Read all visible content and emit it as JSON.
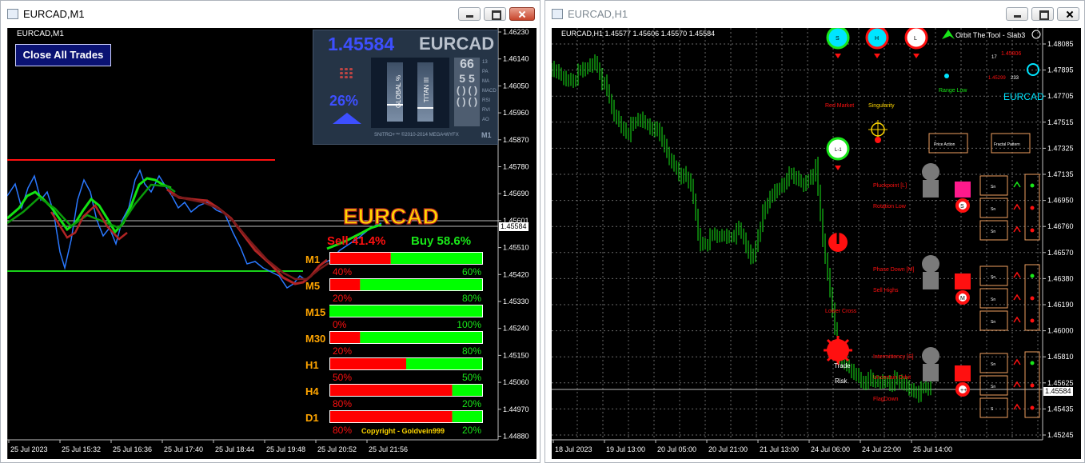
{
  "windows": {
    "m1": {
      "title": "EURCAD,M1",
      "symbol_label": "EURCAD,M1",
      "close_all_label": "Close All Trades",
      "current_price": "1.45584",
      "price_axis": [
        "1.46230",
        "1.46140",
        "1.46050",
        "1.45960",
        "1.45870",
        "1.45780",
        "1.45690",
        "1.45601",
        "1.45510",
        "1.45420",
        "1.45330",
        "1.45240",
        "1.45150",
        "1.45060",
        "1.44970",
        "1.44880"
      ],
      "time_axis": [
        "25 Jul 2023",
        "25 Jul 15:32",
        "25 Jul 16:36",
        "25 Jul 17:40",
        "25 Jul 18:44",
        "25 Jul 19:48",
        "25 Jul 20:52",
        "25 Jul 21:56"
      ],
      "panel": {
        "price": "1.45584",
        "pair": "EURCAD",
        "percent": "26%",
        "col_top": "66",
        "col_values": [
          "5 5",
          "( ) ( )",
          "( ) ( )",
          "( ) ( )"
        ],
        "indicator_labels": [
          "GLOBAL %",
          "TITAN III"
        ],
        "right_labels": [
          "13",
          "PA",
          "MA",
          "MACD",
          "RSI",
          "RVI",
          "AO"
        ],
        "footer": "SNITRO+™ ©2010-2014 MEGA•WYFX",
        "timeframe": "M1"
      },
      "strength": {
        "pair": "EURCAD",
        "sell_label": "Sell 41.4%",
        "buy_label": "Buy 58.6%",
        "copyright": "Copyright - Goldvein999",
        "rows": [
          {
            "tf": "M1",
            "sell": 40,
            "buy": 60,
            "sell_text": "40%",
            "buy_text": "60%"
          },
          {
            "tf": "M5",
            "sell": 20,
            "buy": 80,
            "sell_text": "20%",
            "buy_text": "80%"
          },
          {
            "tf": "M15",
            "sell": 0,
            "buy": 100,
            "sell_text": "0%",
            "buy_text": "100%"
          },
          {
            "tf": "M30",
            "sell": 20,
            "buy": 80,
            "sell_text": "20%",
            "buy_text": "80%"
          },
          {
            "tf": "H1",
            "sell": 50,
            "buy": 50,
            "sell_text": "50%",
            "buy_text": "50%"
          },
          {
            "tf": "H4",
            "sell": 80,
            "buy": 20,
            "sell_text": "80%",
            "buy_text": "20%"
          },
          {
            "tf": "D1",
            "sell": 80,
            "buy": 20,
            "sell_text": "80%",
            "buy_text": "20%"
          }
        ]
      }
    },
    "h1": {
      "title": "EURCAD,H1",
      "symbol_label": "EURCAD,H1  1.45577 1.45606 1.45570 1.45584",
      "current_price": "1.45584",
      "price_axis": [
        "1.48085",
        "1.47895",
        "1.47705",
        "1.47515",
        "1.47325",
        "1.47135",
        "1.46950",
        "1.46760",
        "1.46570",
        "1.46380",
        "1.46190",
        "1.46000",
        "1.45810",
        "1.45625",
        "1.45435",
        "1.45245"
      ],
      "time_axis": [
        "18 Jul 2023",
        "19 Jul 13:00",
        "20 Jul 05:00",
        "20 Jul 21:00",
        "21 Jul 13:00",
        "24 Jul 06:00",
        "24 Jul 22:00",
        "25 Jul 14:00"
      ],
      "top_circles": [
        "S",
        "H",
        "L"
      ],
      "orbit_label": "Orbit The Tool - Slab3",
      "symbol_tag": "EURCAD",
      "small_values": [
        "17",
        "1.45806",
        "1.45299",
        "233"
      ],
      "labels": {
        "range_low": "Range Low",
        "red_market": "Red Market",
        "singularity": "Singularity",
        "price_action": "Price Action",
        "fractal_pattern": "Fractal Pattern",
        "l1": "L-1",
        "pluckpoint": "Pluckpoint [L]",
        "rotation_low": "Rotation Low",
        "phase_down": "Phase Down [M]",
        "sell_highs": "Sell Highs",
        "lower_cross": "Lower Cross",
        "intermittency": "Intermittency [S]",
        "uncertain_orbit": "Uncertain Orbit",
        "flag_down": "FlagDown",
        "trade": "Trade",
        "risk": "Risk",
        "s_letter": "S",
        "m_letter": "M",
        "plus_plus": "++"
      },
      "box_cells": [
        [
          "Sn",
          "Sn",
          "Sn"
        ],
        [
          "Sn",
          "Sn",
          "Sn"
        ],
        [
          "Sn",
          "Sn",
          "S"
        ]
      ]
    }
  },
  "colors": {
    "bg": "#000000",
    "bull": "#00ff00",
    "bear": "#ff0000",
    "accent_blue": "#1e6fff",
    "gold": "#ffd700"
  }
}
